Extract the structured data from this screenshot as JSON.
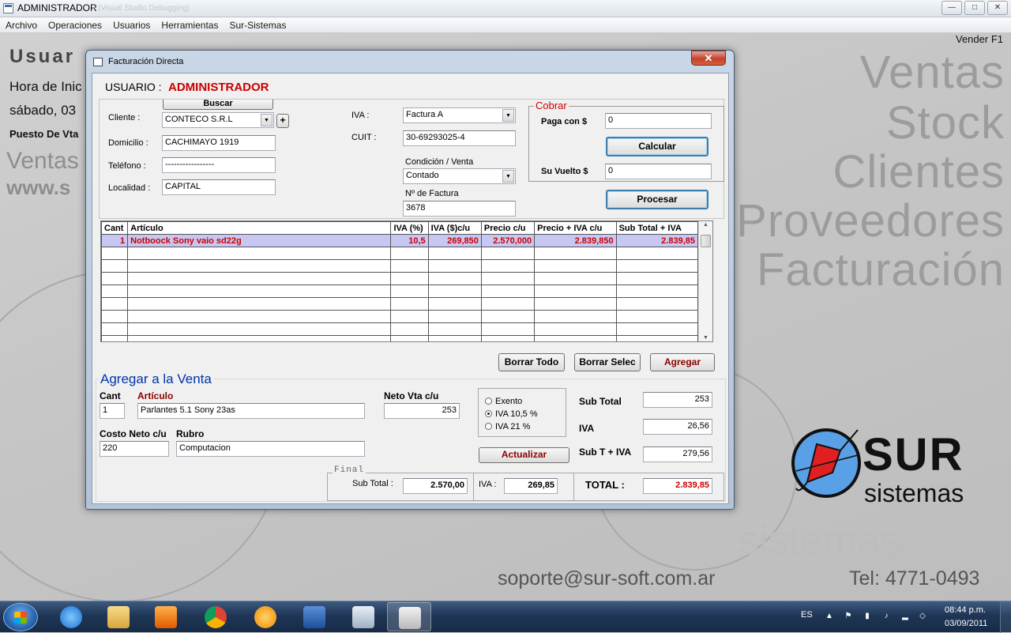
{
  "app": {
    "title": "ADMINISTRADOR",
    "title_ghost": "- (Visual Studio Debugging)",
    "window_buttons": [
      "—",
      "□",
      "✕"
    ],
    "menu": [
      "Archivo",
      "Operaciones",
      "Usuarios",
      "Herramientas",
      "Sur-Sistemas"
    ],
    "vender_hint": "Vender F1"
  },
  "desktop": {
    "usuario_partial": "Usuar",
    "hora_partial": "Hora de Inic",
    "fecha_partial": "sábado, 03",
    "puesto_partial": "Puesto De Vta",
    "ventas_partial": "Ventas",
    "www_partial": "www.s",
    "big_words": [
      "Ventas",
      "Stock",
      "Clientes",
      "Proveedores",
      "Facturación"
    ],
    "email": "soporte@sur-soft.com.ar",
    "tel": "Tel: 4771-0493",
    "logo_main": "SUR",
    "logo_sub": "sistemas",
    "logo_ghost": "sistemas"
  },
  "dialog": {
    "title": "Facturación Directa",
    "close": "✕",
    "usuario_label": "USUARIO :",
    "usuario_value": "ADMINISTRADOR",
    "buscar": "Buscar",
    "plus": "+",
    "cliente_label": "Cliente :",
    "cliente_value": "CONTECO S.R.L",
    "domicilio_label": "Domicilio :",
    "domicilio_value": "CACHIMAYO 1919",
    "telefono_label": "Teléfono :",
    "telefono_value": "-----------------",
    "localidad_label": "Localidad :",
    "localidad_value": "CAPITAL",
    "iva_label": "IVA :",
    "iva_value": "Factura A",
    "cuit_label": "CUIT :",
    "cuit_value": "30-69293025-4",
    "condicion_label": "Condición / Venta",
    "condicion_value": "Contado",
    "nfactura_label": "Nº de Factura",
    "nfactura_value": "3678",
    "cobrar": {
      "title": "Cobrar",
      "paga_label": "Paga con $",
      "paga_value": "0",
      "calcular": "Calcular",
      "vuelto_label": "Su Vuelto $",
      "vuelto_value": "0"
    },
    "procesar": "Procesar",
    "grid": {
      "headers": [
        "Cant",
        "Artículo",
        "IVA (%)",
        "IVA ($)c/u",
        "Precio c/u",
        "Precio + IVA c/u",
        "Sub Total + IVA"
      ],
      "rows": [
        [
          "1",
          "Notboock Sony vaio sd22g",
          "10,5",
          "269,850",
          "2.570,000",
          "2.839,850",
          "2.839,85"
        ]
      ]
    },
    "borrar_todo": "Borrar Todo",
    "borrar_selec": "Borrar Selec",
    "agregar": "Agregar",
    "agregar_venta": {
      "title": "Agregar a la Venta",
      "cant_label": "Cant",
      "cant_value": "1",
      "articulo_label": "Artículo",
      "articulo_value": "Parlantes 5.1  Sony 23as",
      "neto_label": "Neto Vta   c/u",
      "neto_value": "253",
      "costo_label": "Costo Neto c/u",
      "costo_value": "220",
      "rubro_label": "Rubro",
      "rubro_value": "Computacion",
      "radio_exento": "Exento",
      "radio_105": "IVA 10,5 %",
      "radio_21": "IVA 21 %",
      "actualizar": "Actualizar",
      "subtotal_label": "Sub Total",
      "subtotal_value": "253",
      "iva_label": "IVA",
      "iva_value": "26,56",
      "subtiva_label": "Sub T + IVA",
      "subtiva_value": "279,56"
    },
    "final": {
      "title": "Final",
      "subtotal_label": "Sub Total :",
      "subtotal_value": "2.570,00",
      "iva_label": "IVA :",
      "iva_value": "269,85",
      "total_label": "TOTAL :",
      "total_value": "2.839,85"
    }
  },
  "taskbar": {
    "lang": "ES",
    "time": "08:44 p.m.",
    "date": "03/09/2011",
    "tray_icons": [
      "▲",
      "⚑",
      "▮",
      "♪",
      "▂",
      "◇"
    ]
  },
  "colors": {
    "accent_red": "#cc0000",
    "title_blue": "#0033aa",
    "selection": "#c7c7f3"
  }
}
